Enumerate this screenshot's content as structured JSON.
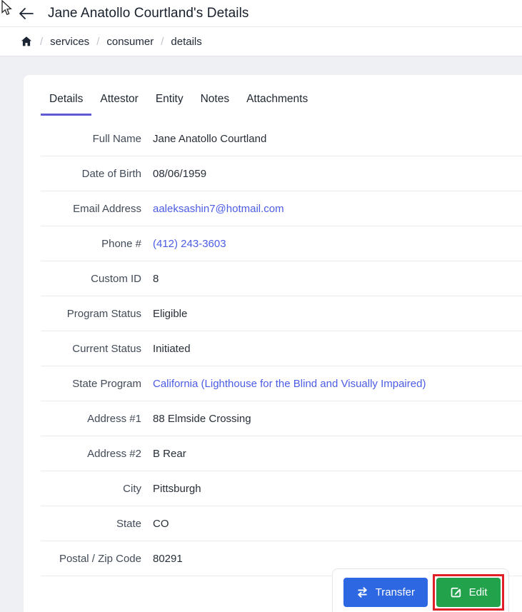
{
  "header": {
    "title": "Jane Anatollo Courtland's Details",
    "back_icon": "arrow-left"
  },
  "breadcrumb": {
    "home_icon": "home",
    "separator": "/",
    "items": [
      "services",
      "consumer",
      "details"
    ]
  },
  "tabs": [
    {
      "label": "Details",
      "active": true
    },
    {
      "label": "Attestor",
      "active": false
    },
    {
      "label": "Entity",
      "active": false
    },
    {
      "label": "Notes",
      "active": false
    },
    {
      "label": "Attachments",
      "active": false
    }
  ],
  "details": {
    "rows": [
      {
        "label": "Full Name",
        "value": "Jane Anatollo Courtland",
        "link": false
      },
      {
        "label": "Date of Birth",
        "value": "08/06/1959",
        "link": false
      },
      {
        "label": "Email Address",
        "value": "aaleksashin7@hotmail.com",
        "link": true
      },
      {
        "label": "Phone #",
        "value": "(412) 243-3603",
        "link": true
      },
      {
        "label": "Custom ID",
        "value": "8",
        "link": false
      },
      {
        "label": "Program Status",
        "value": "Eligible",
        "link": false
      },
      {
        "label": "Current Status",
        "value": "Initiated",
        "link": false
      },
      {
        "label": "State Program",
        "value": "California (Lighthouse for the Blind and Visually Impaired)",
        "link": true
      },
      {
        "label": "Address #1",
        "value": "88 Elmside Crossing",
        "link": false
      },
      {
        "label": "Address #2",
        "value": "B Rear",
        "link": false
      },
      {
        "label": "City",
        "value": "Pittsburgh",
        "link": false
      },
      {
        "label": "State",
        "value": "CO",
        "link": false
      },
      {
        "label": "Postal / Zip Code",
        "value": "80291",
        "link": false
      }
    ]
  },
  "actions": {
    "transfer_label": "Transfer",
    "transfer_icon": "swap-arrows",
    "edit_label": "Edit",
    "edit_icon": "pen-square",
    "edit_highlighted": true
  },
  "colors": {
    "accent_tab": "#6159d4",
    "link": "#4c5ce4",
    "transfer_button": "#2d68e2",
    "edit_button": "#21a24b",
    "highlight_outline": "#e01f26",
    "page_background": "#eef0f3"
  }
}
